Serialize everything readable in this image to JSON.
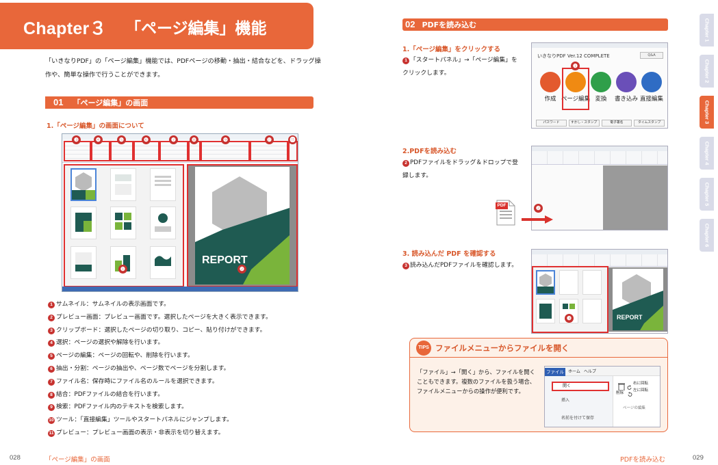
{
  "left": {
    "chapter_banner": {
      "chapter": "Chapter３",
      "title": "「ページ編集」機能"
    },
    "intro": "「いきなりPDF」の「ページ編集」機能では、PDFページの移動・抽出・結合などを、ドラッグ操作や、簡単な操作で行うことができます。",
    "section": {
      "num": "01",
      "title": "「ページ編集」の画面"
    },
    "subhead": "1.「ページ編集」の画面について",
    "screenshot": {
      "cover_text": "REPORT",
      "callouts": [
        "❶",
        "❷",
        "❸",
        "❹",
        "❺",
        "❻",
        "❼",
        "❽",
        "❾",
        "❿",
        "⓫"
      ]
    },
    "legend": [
      {
        "mark": "1",
        "text": "サムネイル：サムネイルの表示画面です。"
      },
      {
        "mark": "2",
        "text": "プレビュー画面：プレビュー画面です。選択したページを大きく表示できます。"
      },
      {
        "mark": "3",
        "text": "クリップボード：選択したページの切り取り、コピー、貼り付けができます。"
      },
      {
        "mark": "4",
        "text": "選択：ページの選択や解除を行います。"
      },
      {
        "mark": "5",
        "text": "ページの編集：ページの回転や、削除を行います。"
      },
      {
        "mark": "6",
        "text": "抽出・分割：ページの抽出や、ページ数でページを分割します。"
      },
      {
        "mark": "7",
        "text": "ファイル名：保存時にファイル名のルールを選択できます。"
      },
      {
        "mark": "8",
        "text": "結合：PDFファイルの結合を行います。"
      },
      {
        "mark": "9",
        "text": "検索：PDFファイル内のテキストを検索します。"
      },
      {
        "mark": "10",
        "text": "ツール：「直接編集」ツールやスタートパネルにジャンプします。"
      },
      {
        "mark": "11",
        "text": "プレビュー：プレビュー画面の表示・非表示を切り替えます。"
      }
    ],
    "page_number": "028",
    "running_title": "「ページ編集」の画面"
  },
  "right": {
    "section": {
      "num": "02",
      "title": "PDFを読み込む"
    },
    "step1": {
      "title": "1.「ページ編集」をクリックする",
      "mark": "1",
      "text": "「スタートパネル」→「ページ編集」をクリックします。"
    },
    "start_panel": {
      "header": "いきなりPDF Ver.12 COMPLETE",
      "header_btn": "Q&A",
      "items": [
        {
          "label": "作成",
          "color": "#e35a2e"
        },
        {
          "label": "ページ編集",
          "color": "#f08a12"
        },
        {
          "label": "変換",
          "color": "#2f9f4a"
        },
        {
          "label": "書き込み",
          "color": "#6a4fb8"
        },
        {
          "label": "直接編集",
          "color": "#2f6cc4"
        }
      ],
      "bottom_buttons": [
        "パスワード",
        "すかし・スタンプ",
        "電子署名",
        "タイムスタンプ"
      ],
      "callout": "❶"
    },
    "step2": {
      "title": "2.PDFを読み込む",
      "mark": "2",
      "text": "PDFファイルをドラッグ＆ドロップで登録します。",
      "file_icon_label": "PDF",
      "callout": "❷"
    },
    "step3": {
      "title": "3. 読み込んだ PDF を確認する",
      "mark": "3",
      "text": "読み込んだPDFファイルを確認します。",
      "cover_text": "REPORT",
      "callout": "❸"
    },
    "tips": {
      "badge": "TIPS",
      "title": "ファイルメニューからファイルを開く",
      "body": "「ファイル」→「開く」から、ファイルを開くこともできます。複数のファイルを扱う場合、ファイルメニューからの操作が便利です。",
      "menu": {
        "tabs": [
          "ファイル",
          "ホーム",
          "ヘルプ"
        ],
        "items": [
          "開く",
          "挿入",
          "名前を付けて保存"
        ],
        "delete": "削除",
        "rotate_right": "右に回転",
        "rotate_left": "左に回転",
        "group_label": "ページの編集"
      }
    },
    "page_number": "029",
    "running_title": "PDFを読み込む",
    "chapter_tabs": [
      "Chapter 1",
      "Chapter 2",
      "Chapter 3",
      "Chapter 4",
      "Chapter 5",
      "Chapter 6"
    ]
  }
}
